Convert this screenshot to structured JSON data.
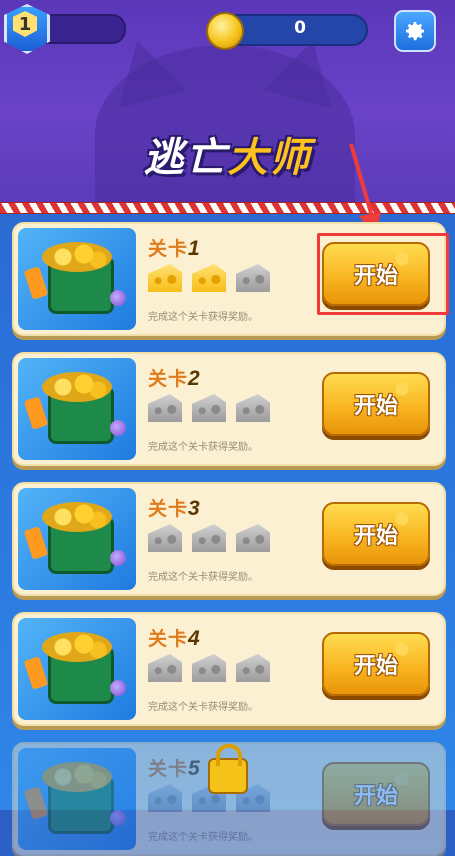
{
  "app": {
    "title_part1": "逃亡",
    "title_part2": "大师"
  },
  "header": {
    "player_level": "1",
    "coins": "0"
  },
  "levels": [
    {
      "label": "关卡",
      "num": "1",
      "stars": [
        "on",
        "on",
        "off"
      ],
      "desc": "完成这个关卡获得奖励。",
      "button": "开始",
      "locked": false
    },
    {
      "label": "关卡",
      "num": "2",
      "stars": [
        "off",
        "off",
        "off"
      ],
      "desc": "完成这个关卡获得奖励。",
      "button": "开始",
      "locked": false
    },
    {
      "label": "关卡",
      "num": "3",
      "stars": [
        "off",
        "off",
        "off"
      ],
      "desc": "完成这个关卡获得奖励。",
      "button": "开始",
      "locked": false
    },
    {
      "label": "关卡",
      "num": "4",
      "stars": [
        "off",
        "off",
        "off"
      ],
      "desc": "完成这个关卡获得奖励。",
      "button": "开始",
      "locked": false
    },
    {
      "label": "关卡",
      "num": "5",
      "stars": [
        "off",
        "off",
        "off"
      ],
      "desc": "完成这个关卡获得奖励。",
      "button": "开始",
      "locked": true
    }
  ],
  "colors": {
    "highlight": "#ef3b3b",
    "accent": "#f8b21e"
  }
}
